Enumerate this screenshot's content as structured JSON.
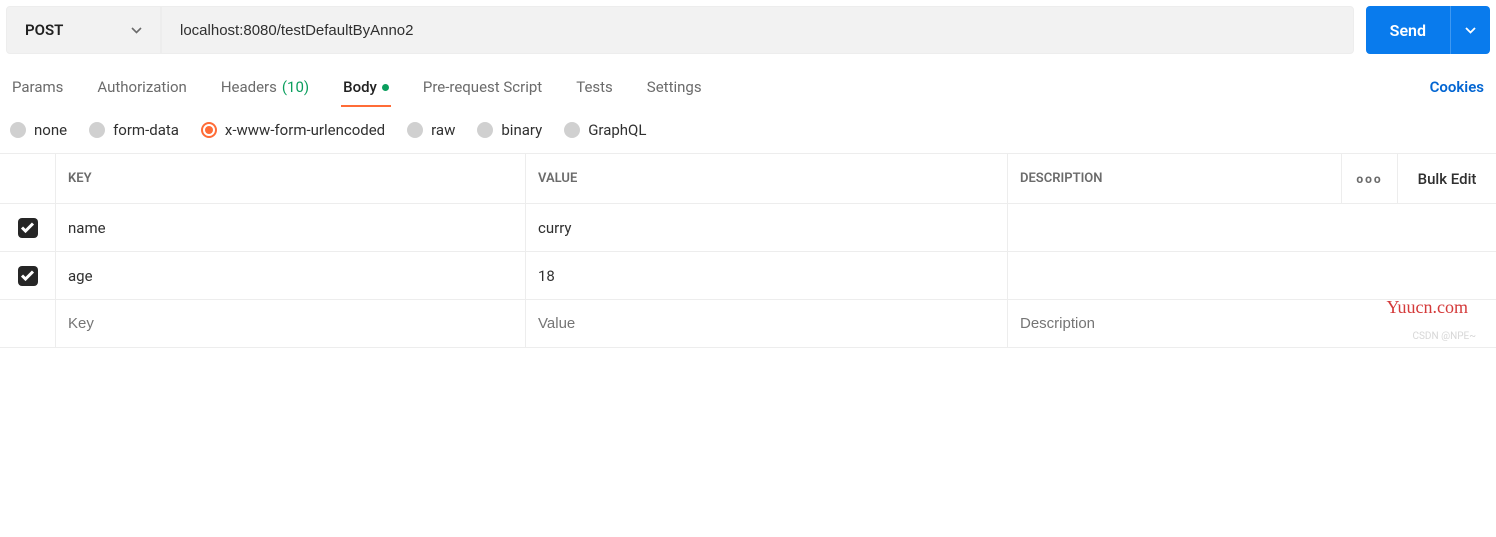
{
  "request": {
    "method": "POST",
    "url": "localhost:8080/testDefaultByAnno2",
    "send_label": "Send"
  },
  "tabs": {
    "items": [
      {
        "label": "Params"
      },
      {
        "label": "Authorization"
      },
      {
        "label": "Headers",
        "count": "(10)"
      },
      {
        "label": "Body",
        "active": true,
        "modified": true
      },
      {
        "label": "Pre-request Script"
      },
      {
        "label": "Tests"
      },
      {
        "label": "Settings"
      }
    ],
    "cookies_label": "Cookies"
  },
  "body_types": {
    "options": [
      {
        "label": "none"
      },
      {
        "label": "form-data"
      },
      {
        "label": "x-www-form-urlencoded",
        "selected": true
      },
      {
        "label": "raw"
      },
      {
        "label": "binary"
      },
      {
        "label": "GraphQL"
      }
    ]
  },
  "table": {
    "headers": {
      "key": "KEY",
      "value": "VALUE",
      "description": "DESCRIPTION",
      "bulk_edit": "Bulk Edit"
    },
    "rows": [
      {
        "checked": true,
        "key": "name",
        "value": "curry",
        "description": ""
      },
      {
        "checked": true,
        "key": "age",
        "value": "18",
        "description": ""
      }
    ],
    "placeholder": {
      "key": "Key",
      "value": "Value",
      "description": "Description"
    }
  },
  "watermark": "Yuucn.com",
  "csdn": "CSDN @NPE~"
}
